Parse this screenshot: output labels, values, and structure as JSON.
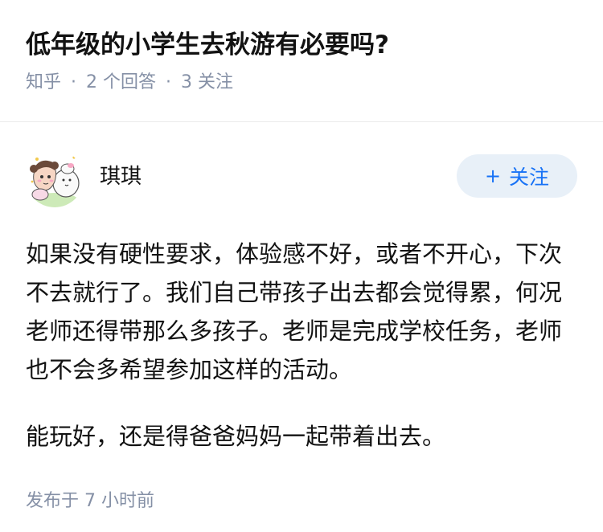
{
  "question": {
    "title": "低年级的小学生去秋游有必要吗?",
    "source": "知乎",
    "answer_count": "2 个回答",
    "follower_count": "3 关注"
  },
  "answer": {
    "author_name": "琪琪",
    "follow_label": "关注",
    "follow_icon": "plus-icon",
    "paragraphs": [
      "如果没有硬性要求，体验感不好，或者不开心，下次不去就行了。我们自己带孩子出去都会觉得累，何况老师还得带那么多孩子。老师是完成学校任务，老师也不会多希望参加这样的活动。",
      "能玩好，还是得爸爸妈妈一起带着出去。"
    ],
    "publish_time": "发布于 7 小时前"
  },
  "colors": {
    "title": "#121212",
    "meta": "#8590a6",
    "follow_bg": "#e8f0f8",
    "follow_text": "#1772f6"
  }
}
